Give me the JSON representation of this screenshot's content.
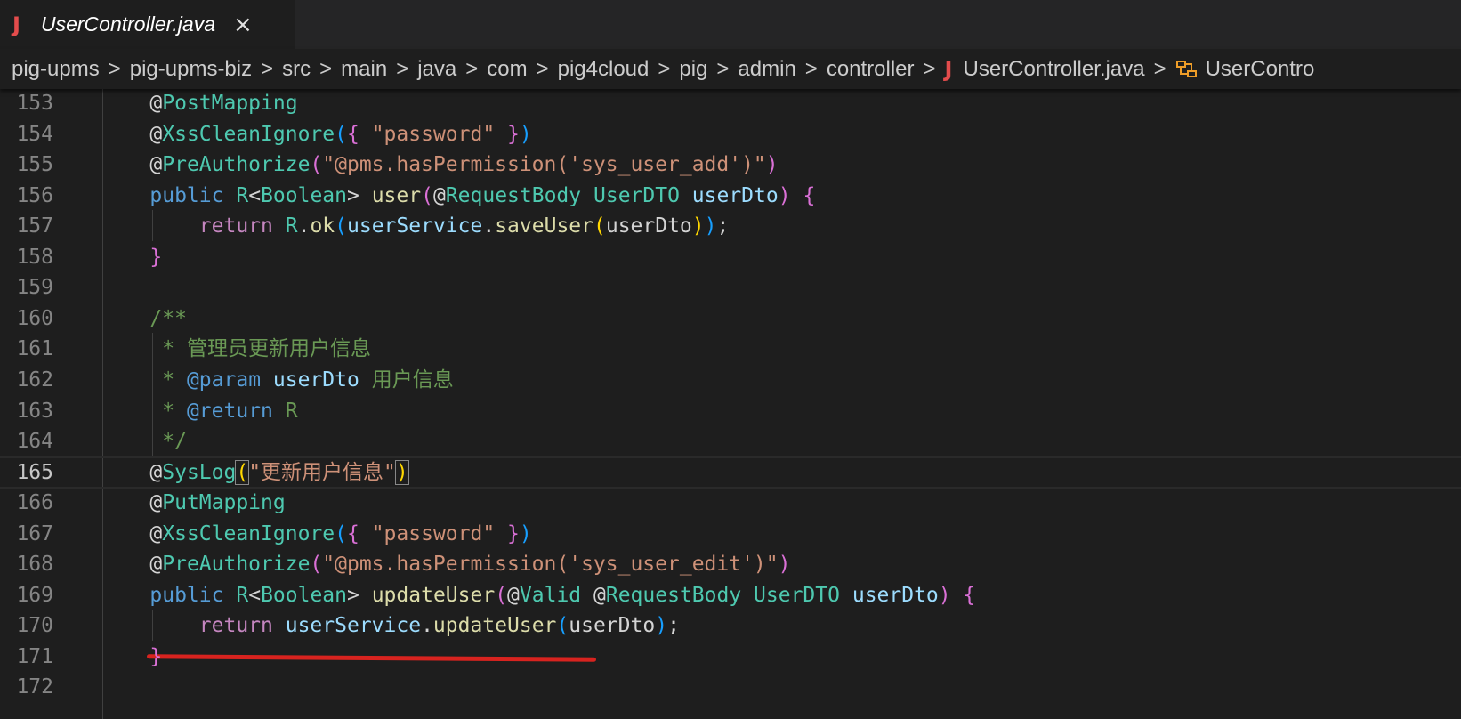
{
  "tab": {
    "icon": "J",
    "title": "UserController.java",
    "close": "×"
  },
  "breadcrumb": {
    "items": [
      "pig-upms",
      "pig-upms-biz",
      "src",
      "main",
      "java",
      "com",
      "pig4cloud",
      "pig",
      "admin",
      "controller"
    ],
    "file_icon": "J",
    "file": "UserController.java",
    "symbol": "UserContro",
    "separator": ">"
  },
  "colors": {
    "background": "#1e1e1e",
    "java_icon": "#e34c4c",
    "annotation": "#4ec9b0",
    "keyword": "#569cd6",
    "string": "#ce9178",
    "comment": "#6a9955",
    "highlight_underline": "#d8231f"
  },
  "editor": {
    "current_line": "165",
    "lines": [
      {
        "n": "153",
        "indent": "    ",
        "tokens": [
          [
            "plain",
            "@"
          ],
          [
            "ann",
            "PostMapping"
          ]
        ]
      },
      {
        "n": "154",
        "indent": "    ",
        "tokens": [
          [
            "plain",
            "@"
          ],
          [
            "ann",
            "XssCleanIgnore"
          ],
          [
            "p3",
            "("
          ],
          [
            "p2",
            "{"
          ],
          [
            "plain",
            " "
          ],
          [
            "str",
            "\"password\""
          ],
          [
            "plain",
            " "
          ],
          [
            "p2",
            "}"
          ],
          [
            "p3",
            ")"
          ]
        ]
      },
      {
        "n": "155",
        "indent": "    ",
        "tokens": [
          [
            "plain",
            "@"
          ],
          [
            "ann",
            "PreAuthorize"
          ],
          [
            "p2",
            "("
          ],
          [
            "str",
            "\"@pms.hasPermission('sys_user_add')\""
          ],
          [
            "p2",
            ")"
          ]
        ]
      },
      {
        "n": "156",
        "indent": "    ",
        "tokens": [
          [
            "kw",
            "public"
          ],
          [
            "plain",
            " "
          ],
          [
            "type",
            "R"
          ],
          [
            "plain",
            "<"
          ],
          [
            "type",
            "Boolean"
          ],
          [
            "plain",
            "> "
          ],
          [
            "fn",
            "user"
          ],
          [
            "p2",
            "("
          ],
          [
            "plain",
            "@"
          ],
          [
            "ann",
            "RequestBody"
          ],
          [
            "plain",
            " "
          ],
          [
            "type",
            "UserDTO"
          ],
          [
            "plain",
            " "
          ],
          [
            "var",
            "userDto"
          ],
          [
            "p2",
            ")"
          ],
          [
            "plain",
            " "
          ],
          [
            "p2",
            "{"
          ]
        ]
      },
      {
        "n": "157",
        "indent": "        ",
        "tokens": [
          [
            "ctl",
            "return"
          ],
          [
            "plain",
            " "
          ],
          [
            "type",
            "R"
          ],
          [
            "plain",
            "."
          ],
          [
            "fn",
            "ok"
          ],
          [
            "p3",
            "("
          ],
          [
            "var",
            "userService"
          ],
          [
            "plain",
            "."
          ],
          [
            "fn",
            "saveUser"
          ],
          [
            "p1",
            "("
          ],
          [
            "plain",
            "userDto"
          ],
          [
            "p1",
            ")"
          ],
          [
            "p3",
            ")"
          ],
          [
            "plain",
            ";"
          ]
        ]
      },
      {
        "n": "158",
        "indent": "    ",
        "tokens": [
          [
            "p2",
            "}"
          ]
        ]
      },
      {
        "n": "159",
        "indent": "",
        "tokens": []
      },
      {
        "n": "160",
        "indent": "    ",
        "tokens": [
          [
            "com",
            "/**"
          ]
        ]
      },
      {
        "n": "161",
        "indent": "     ",
        "tokens": [
          [
            "com",
            "* 管理员更新用户信息"
          ]
        ]
      },
      {
        "n": "162",
        "indent": "     ",
        "tokens": [
          [
            "com",
            "* "
          ],
          [
            "tag",
            "@param"
          ],
          [
            "plain",
            " "
          ],
          [
            "var",
            "userDto"
          ],
          [
            "com",
            " 用户信息"
          ]
        ]
      },
      {
        "n": "163",
        "indent": "     ",
        "tokens": [
          [
            "com",
            "* "
          ],
          [
            "tag",
            "@return"
          ],
          [
            "com",
            " R"
          ]
        ]
      },
      {
        "n": "164",
        "indent": "     ",
        "tokens": [
          [
            "com",
            "*/"
          ]
        ]
      },
      {
        "n": "165",
        "indent": "    ",
        "tokens": [
          [
            "plain",
            "@"
          ],
          [
            "ann",
            "SysLog"
          ],
          [
            "p1",
            "("
          ],
          [
            "str",
            "\"更新用户信息\""
          ],
          [
            "p1",
            ")"
          ]
        ]
      },
      {
        "n": "166",
        "indent": "    ",
        "tokens": [
          [
            "plain",
            "@"
          ],
          [
            "ann",
            "PutMapping"
          ]
        ]
      },
      {
        "n": "167",
        "indent": "    ",
        "tokens": [
          [
            "plain",
            "@"
          ],
          [
            "ann",
            "XssCleanIgnore"
          ],
          [
            "p3",
            "("
          ],
          [
            "p2",
            "{"
          ],
          [
            "plain",
            " "
          ],
          [
            "str",
            "\"password\""
          ],
          [
            "plain",
            " "
          ],
          [
            "p2",
            "}"
          ],
          [
            "p3",
            ")"
          ]
        ]
      },
      {
        "n": "168",
        "indent": "    ",
        "tokens": [
          [
            "plain",
            "@"
          ],
          [
            "ann",
            "PreAuthorize"
          ],
          [
            "p2",
            "("
          ],
          [
            "str",
            "\"@pms.hasPermission('sys_user_edit')\""
          ],
          [
            "p2",
            ")"
          ]
        ]
      },
      {
        "n": "169",
        "indent": "    ",
        "tokens": [
          [
            "kw",
            "public"
          ],
          [
            "plain",
            " "
          ],
          [
            "type",
            "R"
          ],
          [
            "plain",
            "<"
          ],
          [
            "type",
            "Boolean"
          ],
          [
            "plain",
            "> "
          ],
          [
            "fn",
            "updateUser"
          ],
          [
            "p2",
            "("
          ],
          [
            "plain",
            "@"
          ],
          [
            "ann",
            "Valid"
          ],
          [
            "plain",
            " @"
          ],
          [
            "ann",
            "RequestBody"
          ],
          [
            "plain",
            " "
          ],
          [
            "type",
            "UserDTO"
          ],
          [
            "plain",
            " "
          ],
          [
            "var",
            "userDto"
          ],
          [
            "p2",
            ")"
          ],
          [
            "plain",
            " "
          ],
          [
            "p2",
            "{"
          ]
        ]
      },
      {
        "n": "170",
        "indent": "        ",
        "tokens": [
          [
            "ctl",
            "return"
          ],
          [
            "plain",
            " "
          ],
          [
            "var",
            "userService"
          ],
          [
            "plain",
            "."
          ],
          [
            "fn",
            "updateUser"
          ],
          [
            "p3",
            "("
          ],
          [
            "plain",
            "userDto"
          ],
          [
            "p3",
            ")"
          ],
          [
            "plain",
            ";"
          ]
        ]
      },
      {
        "n": "171",
        "indent": "    ",
        "tokens": [
          [
            "p2",
            "}"
          ]
        ]
      },
      {
        "n": "172",
        "indent": "",
        "tokens": []
      }
    ]
  }
}
